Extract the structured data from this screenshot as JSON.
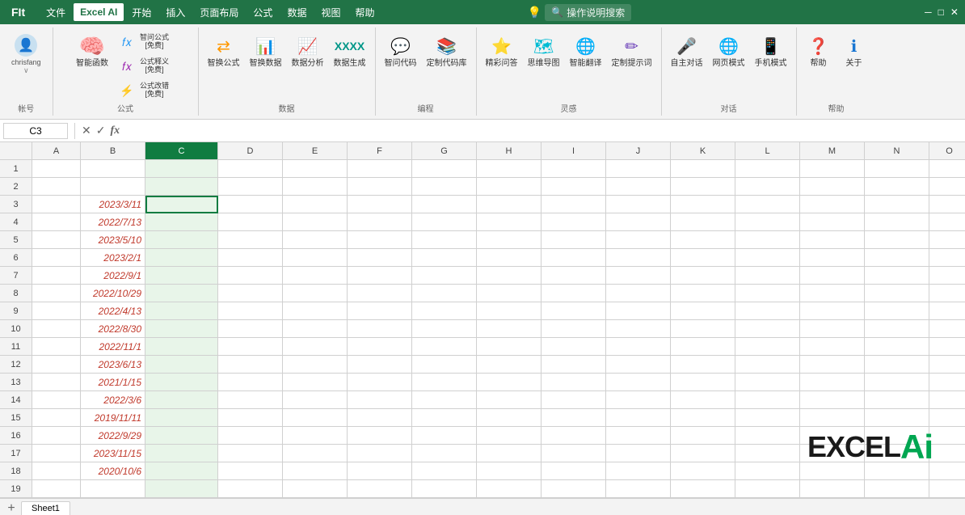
{
  "titlebar": {
    "app_icon": "F",
    "menus": [
      "文件",
      "开始",
      "插入",
      "页面布局",
      "公式",
      "数据",
      "视图",
      "帮助"
    ],
    "active_tab": "Excel AI",
    "search_placeholder": "操作说明搜索",
    "window_controls": [
      "─",
      "□",
      "✕"
    ]
  },
  "ribbon": {
    "groups": [
      {
        "id": "account",
        "items": [
          {
            "label": "帐号",
            "icon": "👤"
          }
        ]
      },
      {
        "id": "formula",
        "label": "公式",
        "items": [
          {
            "label": "智能函数",
            "icon": "🧠",
            "sublabel": ""
          },
          {
            "label": "智问公式\n[免费]",
            "icon": "fx",
            "sublabel": ""
          },
          {
            "label": "公式释义\n[免费]",
            "icon": "fx",
            "sublabel": ""
          },
          {
            "label": "公式改错\n[免费]",
            "icon": "⚡",
            "sublabel": ""
          }
        ]
      },
      {
        "id": "data",
        "label": "数据",
        "items": [
          {
            "label": "智换公式",
            "icon": "⇄"
          },
          {
            "label": "智换数据",
            "icon": "📊"
          },
          {
            "label": "数据分析",
            "icon": "📈"
          },
          {
            "label": "数据生成",
            "icon": "XXXX"
          }
        ]
      },
      {
        "id": "coding",
        "label": "编程",
        "items": [
          {
            "label": "智问代码",
            "icon": "💬"
          },
          {
            "label": "定制代码库",
            "icon": "📚"
          }
        ]
      },
      {
        "id": "inspiration",
        "label": "灵感",
        "items": [
          {
            "label": "精彩问答",
            "icon": "⭐"
          },
          {
            "label": "思维导图",
            "icon": "🗺"
          },
          {
            "label": "智能翻译",
            "icon": "🌐"
          },
          {
            "label": "定制提示词",
            "icon": "✏"
          }
        ]
      },
      {
        "id": "dialog",
        "label": "对话",
        "items": [
          {
            "label": "自主对话",
            "icon": "🎤"
          },
          {
            "label": "网页模式",
            "icon": "🌐"
          },
          {
            "label": "手机模式",
            "icon": "📱"
          }
        ]
      },
      {
        "id": "help",
        "label": "帮助",
        "items": [
          {
            "label": "帮助",
            "icon": "❓"
          },
          {
            "label": "关于",
            "icon": "ℹ"
          }
        ]
      }
    ]
  },
  "formulabar": {
    "cell_ref": "C3",
    "formula_content": ""
  },
  "columns": [
    "A",
    "B",
    "C",
    "D",
    "E",
    "F",
    "G",
    "H",
    "I",
    "J",
    "K",
    "L",
    "M",
    "N",
    "O"
  ],
  "rows": [
    {
      "num": 1,
      "cells": {
        "B": "",
        "C": ""
      }
    },
    {
      "num": 2,
      "cells": {
        "B": "",
        "C": ""
      }
    },
    {
      "num": 3,
      "cells": {
        "B": "2023/3/11",
        "C": ""
      },
      "b_style": "date-red text-right"
    },
    {
      "num": 4,
      "cells": {
        "B": "2022/7/13",
        "C": ""
      },
      "b_style": "date-red text-right"
    },
    {
      "num": 5,
      "cells": {
        "B": "2023/5/10",
        "C": ""
      },
      "b_style": "date-red text-right"
    },
    {
      "num": 6,
      "cells": {
        "B": "2023/2/1",
        "C": ""
      },
      "b_style": "date-red text-right"
    },
    {
      "num": 7,
      "cells": {
        "B": "2022/9/1",
        "C": ""
      },
      "b_style": "date-red text-right"
    },
    {
      "num": 8,
      "cells": {
        "B": "2022/10/29",
        "C": ""
      },
      "b_style": "date-red text-right"
    },
    {
      "num": 9,
      "cells": {
        "B": "2022/4/13",
        "C": ""
      },
      "b_style": "date-red text-right"
    },
    {
      "num": 10,
      "cells": {
        "B": "2022/8/30",
        "C": ""
      },
      "b_style": "date-red text-right"
    },
    {
      "num": 11,
      "cells": {
        "B": "2022/11/1",
        "C": ""
      },
      "b_style": "date-red text-right"
    },
    {
      "num": 12,
      "cells": {
        "B": "2023/6/13",
        "C": ""
      },
      "b_style": "date-red text-right"
    },
    {
      "num": 13,
      "cells": {
        "B": "2021/1/15",
        "C": ""
      },
      "b_style": "date-red text-right"
    },
    {
      "num": 14,
      "cells": {
        "B": "2022/3/6",
        "C": ""
      },
      "b_style": "date-red text-right"
    },
    {
      "num": 15,
      "cells": {
        "B": "2019/11/11",
        "C": ""
      },
      "b_style": "date-red text-right"
    },
    {
      "num": 16,
      "cells": {
        "B": "2022/9/29",
        "C": ""
      },
      "b_style": "date-red text-right"
    },
    {
      "num": 17,
      "cells": {
        "B": "2023/11/15",
        "C": ""
      },
      "b_style": "date-red text-right"
    },
    {
      "num": 18,
      "cells": {
        "B": "2020/10/6",
        "C": ""
      },
      "b_style": "date-red text-right"
    },
    {
      "num": 19,
      "cells": {
        "B": "",
        "C": ""
      }
    }
  ],
  "active_cell": "C3",
  "selected_col": "C",
  "sheet_tabs": [
    "Sheet1"
  ],
  "logo": {
    "text_dark": "EXCEL",
    "text_green": "Ai"
  }
}
